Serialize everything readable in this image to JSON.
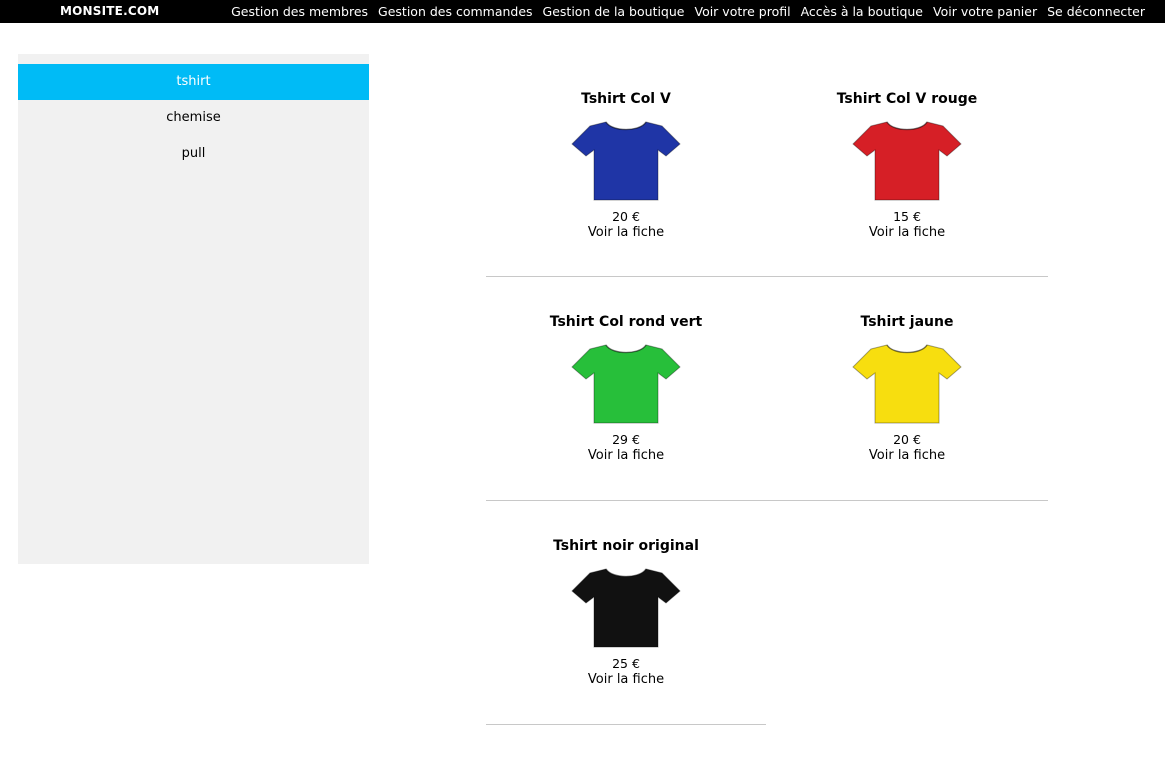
{
  "header": {
    "brand": "MONSITE.COM",
    "menu": [
      "Gestion des membres",
      "Gestion des commandes",
      "Gestion de la boutique",
      "Voir votre profil",
      "Accès à la boutique",
      "Voir votre panier",
      "Se déconnecter"
    ]
  },
  "sidebar": {
    "categories": [
      "tshirt",
      "chemise",
      "pull"
    ],
    "active": "tshirt",
    "active_color": "#00bbf6"
  },
  "products": [
    {
      "title": "Tshirt Col V",
      "price": "20 €",
      "link": "Voir la fiche",
      "color": "#1f35a6",
      "icon": "tshirt-icon"
    },
    {
      "title": "Tshirt Col V rouge",
      "price": "15 €",
      "link": "Voir la fiche",
      "color": "#d61f26",
      "icon": "tshirt-icon"
    },
    {
      "title": "Tshirt Col rond vert",
      "price": "29 €",
      "link": "Voir la fiche",
      "color": "#27bf3a",
      "icon": "tshirt-icon"
    },
    {
      "title": "Tshirt jaune",
      "price": "20 €",
      "link": "Voir la fiche",
      "color": "#f7de0f",
      "icon": "tshirt-icon"
    },
    {
      "title": "Tshirt noir original",
      "price": "25 €",
      "link": "Voir la fiche",
      "color": "#111111",
      "icon": "tshirt-icon"
    }
  ]
}
